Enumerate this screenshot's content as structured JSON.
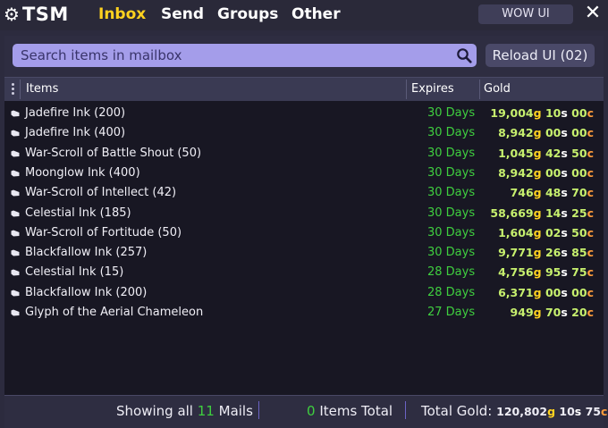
{
  "logo": {
    "text": "TSM"
  },
  "tabs": [
    {
      "label": "Inbox",
      "active": true
    },
    {
      "label": "Send",
      "active": false
    },
    {
      "label": "Groups",
      "active": false
    },
    {
      "label": "Other",
      "active": false
    }
  ],
  "header_button": "WOW UI",
  "close_glyph": "✕",
  "search": {
    "placeholder": "Search items in mailbox",
    "icon": "search-icon"
  },
  "reload_label": "Reload UI (02)",
  "columns": {
    "items": "Items",
    "expires": "Expires",
    "gold": "Gold"
  },
  "rows": [
    {
      "name": "Jadefire Ink (200)",
      "expires": "30 Days",
      "g": "19,004",
      "s": "10",
      "c": "00"
    },
    {
      "name": "Jadefire Ink (400)",
      "expires": "30 Days",
      "g": "8,942",
      "s": "00",
      "c": "00"
    },
    {
      "name": "War-Scroll of Battle Shout (50)",
      "expires": "30 Days",
      "g": "1,045",
      "s": "42",
      "c": "50"
    },
    {
      "name": "Moonglow Ink (400)",
      "expires": "30 Days",
      "g": "8,942",
      "s": "00",
      "c": "00"
    },
    {
      "name": "War-Scroll of Intellect (42)",
      "expires": "30 Days",
      "g": "746",
      "s": "48",
      "c": "70"
    },
    {
      "name": "Celestial Ink (185)",
      "expires": "30 Days",
      "g": "58,669",
      "s": "14",
      "c": "25"
    },
    {
      "name": "War-Scroll of Fortitude (50)",
      "expires": "30 Days",
      "g": "1,604",
      "s": "02",
      "c": "50"
    },
    {
      "name": "Blackfallow Ink (257)",
      "expires": "30 Days",
      "g": "9,771",
      "s": "26",
      "c": "85"
    },
    {
      "name": "Celestial Ink (15)",
      "expires": "28 Days",
      "g": "4,756",
      "s": "95",
      "c": "75"
    },
    {
      "name": "Blackfallow Ink (200)",
      "expires": "28 Days",
      "g": "6,371",
      "s": "00",
      "c": "00"
    },
    {
      "name": "Glyph of the Aerial Chameleon",
      "expires": "27 Days",
      "g": "949",
      "s": "70",
      "s2": "",
      "c": "20"
    }
  ],
  "footer": {
    "showing_prefix": "Showing all",
    "mail_count": "11",
    "mails_suffix": "Mails",
    "items_count": "0",
    "items_suffix": "Items Total",
    "total_label": "Total Gold:",
    "total_g": "120,802",
    "total_s": "10",
    "total_c": "75"
  },
  "currency": {
    "g": "g",
    "s": "s",
    "c": "c"
  },
  "colors": {
    "accent": "#ffd21f",
    "expires": "#3fcf3f",
    "search_bg": "#a49dea"
  }
}
